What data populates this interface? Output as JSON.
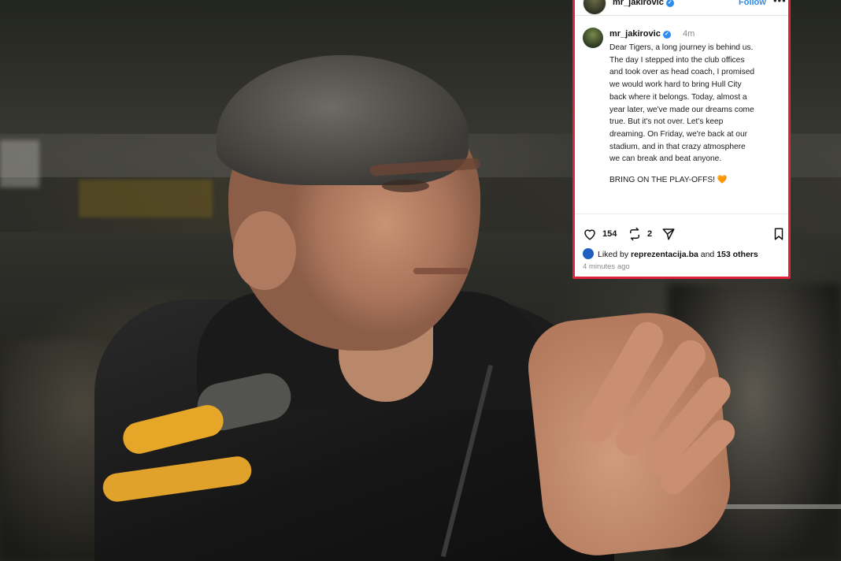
{
  "post": {
    "username": "mr_jakirovic",
    "follow_label": "Follow",
    "more_label": "•••",
    "time": "4m",
    "caption_lines": [
      "Dear Tigers, a long journey is behind us.",
      "The day I stepped into the club offices",
      "and took over as head coach, I promised",
      "we would work hard to bring Hull City",
      "back where it belongs. Today, almost a",
      "year later, we've made our dreams come",
      "true. But it's not over. Let's keep",
      "dreaming. On Friday, we're back at our",
      "stadium, and in that crazy atmosphere",
      "we can break and beat anyone."
    ],
    "closing_line": "BRING ON THE PLAY-OFFS! 🧡",
    "likes": "154",
    "reposts": "2",
    "liked_by_prefix": "Liked by ",
    "liked_by_user": "reprezentacija.ba",
    "liked_by_middle": " and ",
    "liked_by_others": "153 others",
    "timestamp": "4 minutes ago"
  },
  "photo": {
    "jacket_logo": "ᴥᴥ"
  },
  "colors": {
    "card_border": "#e0213a",
    "verified_blue": "#2d8cf0",
    "jacket_accent": "#e6a628"
  }
}
